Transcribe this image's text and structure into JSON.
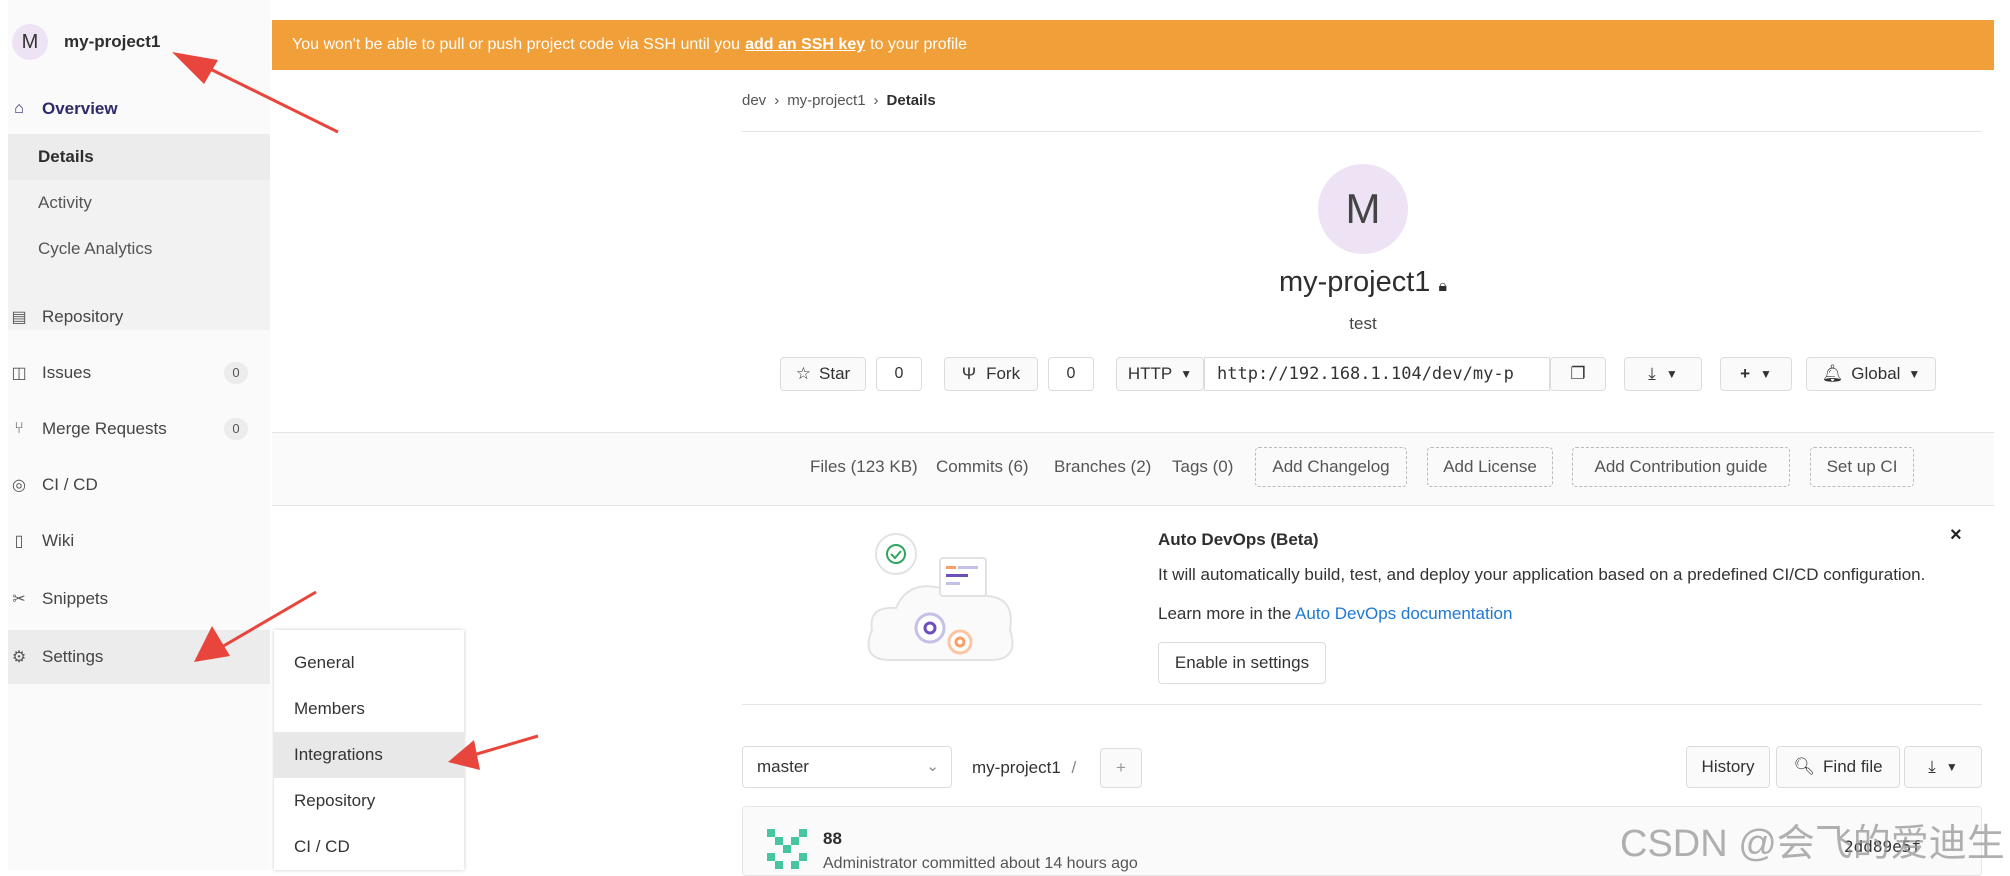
{
  "banner": {
    "before": "You won't be able to pull or push project code via SSH until you",
    "link": "add an SSH key",
    "after": "to your profile"
  },
  "sidebar": {
    "avatar_letter": "M",
    "project_name": "my-project1",
    "overview": "Overview",
    "subitems": [
      "Details",
      "Activity",
      "Cycle Analytics"
    ],
    "repository": "Repository",
    "issues": "Issues",
    "issues_count": "0",
    "merge_requests": "Merge Requests",
    "mr_count": "0",
    "cicd": "CI / CD",
    "wiki": "Wiki",
    "snippets": "Snippets",
    "settings": "Settings"
  },
  "settings_menu": [
    "General",
    "Members",
    "Integrations",
    "Repository",
    "CI / CD"
  ],
  "breadcrumbs": {
    "group": "dev",
    "project": "my-project1",
    "current": "Details"
  },
  "project": {
    "avatar_letter": "M",
    "name": "my-project1",
    "description": "test"
  },
  "actions": {
    "star": "Star",
    "star_count": "0",
    "fork": "Fork",
    "fork_count": "0",
    "protocol": "HTTP",
    "clone_url": "http://192.168.1.104/dev/my-p",
    "notification": "Global"
  },
  "stats": {
    "files": "Files (123 KB)",
    "commits": "Commits (6)",
    "branches": "Branches (2)",
    "tags": "Tags (0)",
    "add_changelog": "Add Changelog",
    "add_license": "Add License",
    "add_contribution": "Add Contribution guide",
    "setup_ci": "Set up CI"
  },
  "autodevops": {
    "title": "Auto DevOps (Beta)",
    "text": "It will automatically build, test, and deploy your application based on a predefined CI/CD configuration.",
    "learn_prefix": "Learn more in the",
    "learn_link": "Auto DevOps documentation",
    "button": "Enable in settings",
    "close": "×"
  },
  "repo": {
    "branch": "master",
    "path": "my-project1",
    "separator": "/",
    "history": "History",
    "find_file": "Find file"
  },
  "commit": {
    "title": "88",
    "meta": "Administrator committed about 14 hours ago",
    "sha": "2dd89e5f"
  },
  "watermark": "CSDN @会飞的爱迪生",
  "colors": {
    "banner": "#f09f39",
    "link": "#1f78d1",
    "arrow": "#e8453c",
    "avatar_bg": "#eee3f4"
  }
}
